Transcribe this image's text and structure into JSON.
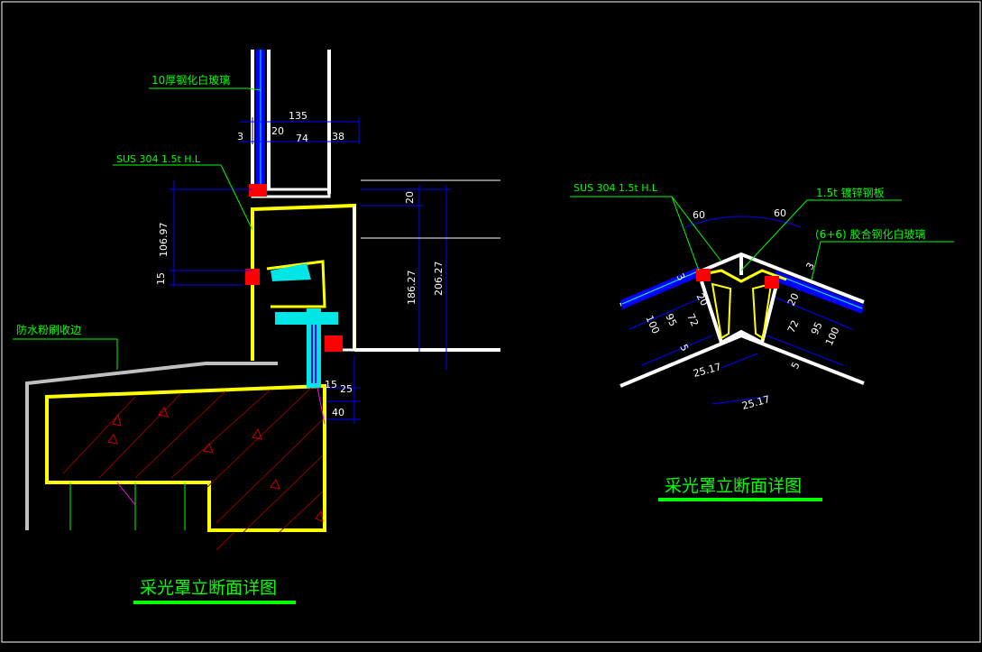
{
  "left_detail": {
    "labels": {
      "glass": "10厚钢化白玻璃",
      "steel": "SUS 304 1.5t H.L",
      "waterproof": "防水粉刷收边"
    },
    "dims": {
      "d135": "135",
      "d3": "3",
      "d20a": "20",
      "d74": "74",
      "d38": "38",
      "d20b": "20",
      "d106": "106.97",
      "d15a": "15",
      "d186": "186.27",
      "d206": "206.27",
      "d15b": "15",
      "d25": "25",
      "d40": "40"
    },
    "title": "采光罩立断面详图"
  },
  "right_detail": {
    "labels": {
      "steel": "SUS 304 1.5t H.L",
      "galv": "1.5t 镀锌钢板",
      "laminated": "(6+6) 胶合钢化白玻璃"
    },
    "dims": {
      "a60l": "60",
      "a60r": "60",
      "l3": "3",
      "l20": "20",
      "l100": "100",
      "l95": "95",
      "l72": "72",
      "l5": "5",
      "r3": "3",
      "r20": "20",
      "r72": "72",
      "r95": "95",
      "r100": "100",
      "r5": "5",
      "b2517a": "25.17",
      "b2517b": "25.17"
    },
    "title": "采光罩立断面详图"
  },
  "colors": {
    "background": "#000000",
    "label_green": "#00ff00",
    "frame_yellow": "#ffff00",
    "dim_blue": "#0000ff",
    "accent_red": "#ff0000",
    "hatch_red": "#cc0000",
    "cyan": "#00e5e5",
    "wall_gray": "#c0c0c0"
  }
}
